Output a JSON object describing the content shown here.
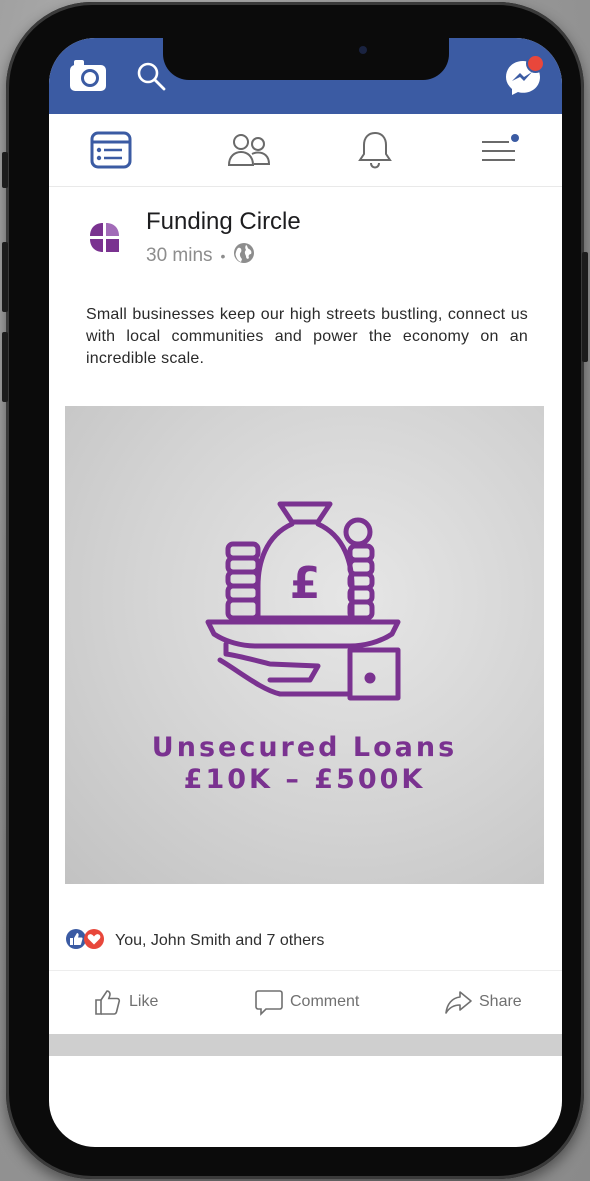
{
  "status_bar": {
    "camera_icon": "camera-icon",
    "search_icon": "search-icon",
    "messenger_icon": "messenger-icon"
  },
  "nav": {
    "items": [
      {
        "name": "news-feed",
        "icon": "news-feed-icon",
        "active": true
      },
      {
        "name": "friends",
        "icon": "friends-icon",
        "active": false
      },
      {
        "name": "notifications",
        "icon": "bell-icon",
        "active": false
      },
      {
        "name": "menu",
        "icon": "menu-icon",
        "active": false
      }
    ]
  },
  "post": {
    "author": "Funding Circle",
    "time": "30 mins",
    "separator": "•",
    "text": "Small businesses keep our high streets bustling, connect us with local communities and power the economy on an incredible scale.",
    "image": {
      "title_line1": "Unsecured Loans",
      "title_line2": "£10K – £500K",
      "symbol": "£"
    },
    "reactions_text": "You, John Smith and 7 others",
    "actions": {
      "like": "Like",
      "comment": "Comment",
      "share": "Share"
    }
  },
  "colors": {
    "facebook_blue": "#3b5ba3",
    "brand_purple": "#7a3290",
    "notification_red": "#e8473b"
  }
}
